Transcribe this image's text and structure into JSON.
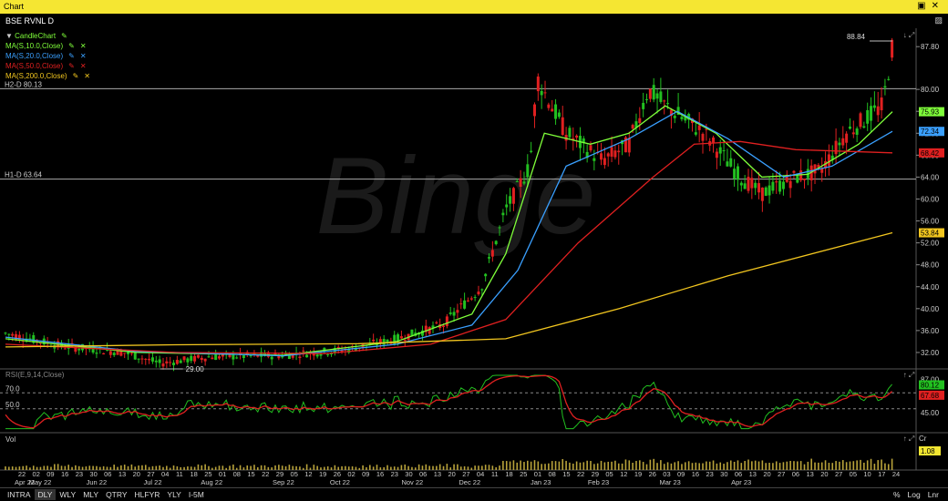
{
  "window": {
    "title": "Chart",
    "controls": [
      "▣",
      "✕"
    ]
  },
  "symbol_bar": {
    "title": "BSE RVNL D",
    "restore_icon": "▨"
  },
  "legend": {
    "candle": "CandleChart",
    "ma": [
      {
        "label": "MA(S,10.0,Close)",
        "color": "#7fff3a"
      },
      {
        "label": "MA(S,20.0,Close)",
        "color": "#3aa0ff"
      },
      {
        "label": "MA(S,50.0,Close)",
        "color": "#e02020"
      },
      {
        "label": "MA(S,200.0,Close)",
        "color": "#f2c61f"
      }
    ]
  },
  "hlines": [
    {
      "label": "H2-D 80.13",
      "value": 80.13
    },
    {
      "label": "H1-D 63.64",
      "value": 63.64
    }
  ],
  "price_axis": {
    "ticks": [
      "87.80",
      "80.00",
      "76.00",
      "72.00",
      "68.00",
      "64.00",
      "60.00",
      "56.00",
      "52.00",
      "48.00",
      "44.00",
      "40.00",
      "36.00",
      "32.00"
    ]
  },
  "last_values": [
    {
      "label": "75.93",
      "value": 75.93,
      "color": "#7fff3a"
    },
    {
      "label": "72.34",
      "value": 72.34,
      "color": "#3aa0ff"
    },
    {
      "label": "68.42",
      "value": 68.42,
      "color": "#e02020"
    },
    {
      "label": "53.84",
      "value": 53.84,
      "color": "#f2c61f"
    }
  ],
  "annotations": {
    "high": "88.84",
    "low": "29.00"
  },
  "rsi": {
    "label": "RSI(E,9,14,Close)",
    "levels": [
      "70.0",
      "50.0"
    ],
    "axis": [
      "87.00",
      "65.00",
      "45.00"
    ],
    "last": [
      "80.12",
      "67.68"
    ]
  },
  "vol": {
    "label": "Vol",
    "axis": "Cr",
    "last": "1.08"
  },
  "x_axis": {
    "days": [
      "22",
      "02",
      "09",
      "16",
      "23",
      "30",
      "06",
      "13",
      "20",
      "27",
      "04",
      "11",
      "18",
      "25",
      "01",
      "08",
      "15",
      "22",
      "29",
      "05",
      "12",
      "19",
      "26",
      "02",
      "09",
      "16",
      "23",
      "30",
      "06",
      "13",
      "20",
      "27",
      "04",
      "11",
      "18",
      "25",
      "01",
      "08",
      "15",
      "22",
      "29",
      "05",
      "12",
      "19",
      "26",
      "03",
      "09",
      "16",
      "23",
      "30",
      "06",
      "13",
      "20",
      "27",
      "06",
      "13",
      "20",
      "27",
      "05",
      "10",
      "17",
      "24"
    ],
    "months": [
      "Apr 22",
      "May 22",
      "Jun 22",
      "Jul 22",
      "Aug 22",
      "Sep 22",
      "Oct 22",
      "Nov 22",
      "Dec 22",
      "Jan 23",
      "Feb 23",
      "Mar 23",
      "Apr 23"
    ]
  },
  "bottom_tabs": [
    {
      "label": "INTRA",
      "selected": false
    },
    {
      "label": "DLY",
      "selected": true
    },
    {
      "label": "WLY",
      "selected": false
    },
    {
      "label": "MLY",
      "selected": false
    },
    {
      "label": "QTRY",
      "selected": false
    },
    {
      "label": "HLFYR",
      "selected": false
    },
    {
      "label": "YLY",
      "selected": false
    },
    {
      "label": "I-5M",
      "selected": false
    }
  ],
  "bottom_right": [
    "%",
    "Log",
    "Lnr"
  ],
  "watermark": "Binge",
  "chart_data": {
    "type": "line",
    "title": "BSE RVNL D",
    "ylim": [
      29,
      89
    ],
    "x_start": "2022-04-22",
    "x_end": "2023-04-24",
    "series": [
      {
        "name": "Close",
        "points": [
          [
            "2022-04-22",
            35.5
          ],
          [
            "2022-05-15",
            33.2
          ],
          [
            "2022-06-10",
            32.0
          ],
          [
            "2022-06-25",
            30.0
          ],
          [
            "2022-07-15",
            31.2
          ],
          [
            "2022-08-15",
            31.5
          ],
          [
            "2022-09-10",
            32.5
          ],
          [
            "2022-10-01",
            34.5
          ],
          [
            "2022-10-20",
            37.0
          ],
          [
            "2022-11-05",
            44.0
          ],
          [
            "2022-11-15",
            58.0
          ],
          [
            "2022-11-25",
            66.0
          ],
          [
            "2022-11-28",
            82.0
          ],
          [
            "2022-12-10",
            72.0
          ],
          [
            "2022-12-25",
            67.0
          ],
          [
            "2023-01-05",
            70.0
          ],
          [
            "2023-01-13",
            80.0
          ],
          [
            "2023-01-20",
            77.0
          ],
          [
            "2023-02-05",
            72.0
          ],
          [
            "2023-02-20",
            64.0
          ],
          [
            "2023-03-01",
            61.0
          ],
          [
            "2023-03-15",
            64.0
          ],
          [
            "2023-03-25",
            65.0
          ],
          [
            "2023-04-05",
            72.0
          ],
          [
            "2023-04-20",
            77.0
          ],
          [
            "2023-04-24",
            87.8
          ]
        ]
      },
      {
        "name": "MA(S,10.0,Close)",
        "points": [
          [
            "2022-04-22",
            34.5
          ],
          [
            "2022-06-15",
            32.0
          ],
          [
            "2022-08-15",
            31.5
          ],
          [
            "2022-10-01",
            34.0
          ],
          [
            "2022-11-01",
            39.0
          ],
          [
            "2022-11-15",
            50.0
          ],
          [
            "2022-12-01",
            72.0
          ],
          [
            "2022-12-20",
            70.0
          ],
          [
            "2023-01-05",
            72.0
          ],
          [
            "2023-01-20",
            77.0
          ],
          [
            "2023-02-10",
            72.0
          ],
          [
            "2023-03-01",
            64.0
          ],
          [
            "2023-03-20",
            64.5
          ],
          [
            "2023-04-10",
            70.0
          ],
          [
            "2023-04-24",
            75.93
          ]
        ]
      },
      {
        "name": "MA(S,20.0,Close)",
        "points": [
          [
            "2022-04-22",
            34.8
          ],
          [
            "2022-06-15",
            32.2
          ],
          [
            "2022-08-15",
            31.4
          ],
          [
            "2022-10-01",
            33.5
          ],
          [
            "2022-11-01",
            37.0
          ],
          [
            "2022-11-20",
            47.0
          ],
          [
            "2022-12-10",
            66.0
          ],
          [
            "2023-01-05",
            71.0
          ],
          [
            "2023-01-25",
            76.0
          ],
          [
            "2023-02-15",
            71.0
          ],
          [
            "2023-03-10",
            64.0
          ],
          [
            "2023-03-30",
            66.0
          ],
          [
            "2023-04-24",
            72.34
          ]
        ]
      },
      {
        "name": "MA(S,50.0,Close)",
        "points": [
          [
            "2022-04-22",
            33.5
          ],
          [
            "2022-07-01",
            32.0
          ],
          [
            "2022-09-01",
            31.8
          ],
          [
            "2022-10-15",
            33.5
          ],
          [
            "2022-11-15",
            38.0
          ],
          [
            "2022-12-15",
            52.0
          ],
          [
            "2023-01-15",
            64.0
          ],
          [
            "2023-02-01",
            70.0
          ],
          [
            "2023-02-20",
            70.5
          ],
          [
            "2023-03-15",
            69.0
          ],
          [
            "2023-04-24",
            68.42
          ]
        ]
      },
      {
        "name": "MA(S,200.0,Close)",
        "points": [
          [
            "2022-04-22",
            33.0
          ],
          [
            "2022-07-01",
            33.4
          ],
          [
            "2022-09-15",
            33.6
          ],
          [
            "2022-11-15",
            34.5
          ],
          [
            "2023-01-01",
            40.0
          ],
          [
            "2023-02-15",
            46.0
          ],
          [
            "2023-04-24",
            53.84
          ]
        ]
      }
    ]
  }
}
